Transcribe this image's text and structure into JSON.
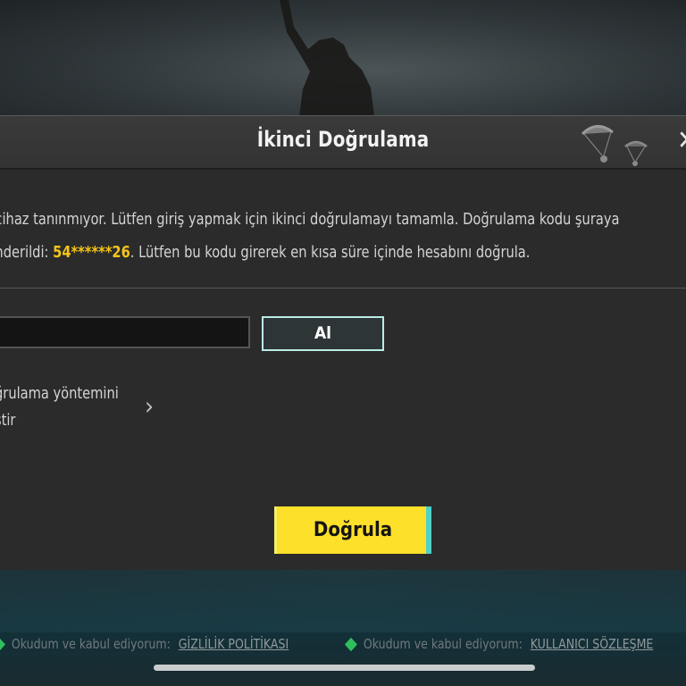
{
  "dialog": {
    "title": "İkinci Doğrulama",
    "message": {
      "line1": "cihaz tanınmıyor. Lütfen giriş yapmak için ikinci doğrulamayı tamamla. Doğrulama kodu şuraya",
      "line2_before": "nderildi: ",
      "code": "54******26",
      "line2_after": ". Lütfen bu kodu girerek en kısa süre içinde hesabını doğrula."
    },
    "code_input": {
      "value": "",
      "placeholder": ""
    },
    "get_code_button": "Al",
    "change_method": {
      "line1": "ğrulama yöntemini",
      "line2": "ştir"
    },
    "verify_button": "Doğrula"
  },
  "footer": {
    "agreements": [
      {
        "text": "Okudum ve kabul ediyorum:",
        "link": "GİZLİLİK POLİTİKASI"
      },
      {
        "text": "Okudum ve kabul ediyorum:",
        "link": "KULLANICI SÖZLEŞME"
      }
    ]
  },
  "icons": {
    "close": "close-icon",
    "chevron": "chevron-right-icon",
    "agree_marker": "diamond-icon",
    "decoration": "parachute-icon"
  },
  "colors": {
    "code_highlight": "#f5c518",
    "verify_button": "#fde02a",
    "get_button_border": "#b9ece6",
    "agree_marker": "#2fbf5d"
  }
}
